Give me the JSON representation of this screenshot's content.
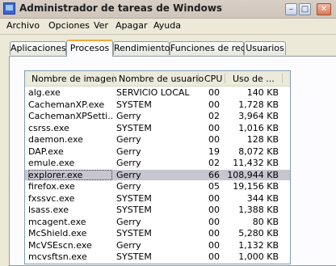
{
  "window": {
    "title": "Administrador de tareas de Windows"
  },
  "titlebar_buttons": {
    "minimize": "–",
    "maximize": "□",
    "close": "✕"
  },
  "menu": [
    "Archivo",
    "Opciones",
    "Ver",
    "Apagar",
    "Ayuda"
  ],
  "tabs": [
    {
      "label": "Aplicaciones"
    },
    {
      "label": "Procesos",
      "active": true
    },
    {
      "label": "Rendimiento"
    },
    {
      "label": "Funciones de red"
    },
    {
      "label": "Usuarios"
    }
  ],
  "table": {
    "headers": [
      "Nombre de imagen",
      "Nombre de usuario",
      "CPU",
      "Uso de ..."
    ],
    "rows": [
      {
        "name": "alg.exe",
        "user": "SERVICIO LOCAL",
        "cpu": "00",
        "mem": "140 KB"
      },
      {
        "name": "CachemanXP.exe",
        "user": "SYSTEM",
        "cpu": "00",
        "mem": "1,728 KB"
      },
      {
        "name": "CachemanXPSetti...",
        "user": "Gerry",
        "cpu": "02",
        "mem": "3,964 KB"
      },
      {
        "name": "csrss.exe",
        "user": "SYSTEM",
        "cpu": "00",
        "mem": "1,016 KB"
      },
      {
        "name": "daemon.exe",
        "user": "Gerry",
        "cpu": "00",
        "mem": "128 KB"
      },
      {
        "name": "DAP.exe",
        "user": "Gerry",
        "cpu": "19",
        "mem": "8,072 KB"
      },
      {
        "name": "emule.exe",
        "user": "Gerry",
        "cpu": "02",
        "mem": "11,432 KB"
      },
      {
        "name": "explorer.exe",
        "user": "Gerry",
        "cpu": "66",
        "mem": "108,944 KB",
        "selected": true
      },
      {
        "name": "firefox.exe",
        "user": "Gerry",
        "cpu": "05",
        "mem": "19,156 KB"
      },
      {
        "name": "fxssvc.exe",
        "user": "SYSTEM",
        "cpu": "00",
        "mem": "344 KB"
      },
      {
        "name": "lsass.exe",
        "user": "SYSTEM",
        "cpu": "00",
        "mem": "1,388 KB"
      },
      {
        "name": "mcagent.exe",
        "user": "Gerry",
        "cpu": "00",
        "mem": "80 KB"
      },
      {
        "name": "McShield.exe",
        "user": "SYSTEM",
        "cpu": "00",
        "mem": "5,280 KB"
      },
      {
        "name": "McVSEscn.exe",
        "user": "Gerry",
        "cpu": "00",
        "mem": "1,132 KB"
      },
      {
        "name": "mcvsftsn.exe",
        "user": "SYSTEM",
        "cpu": "00",
        "mem": "1,000 KB"
      }
    ]
  }
}
